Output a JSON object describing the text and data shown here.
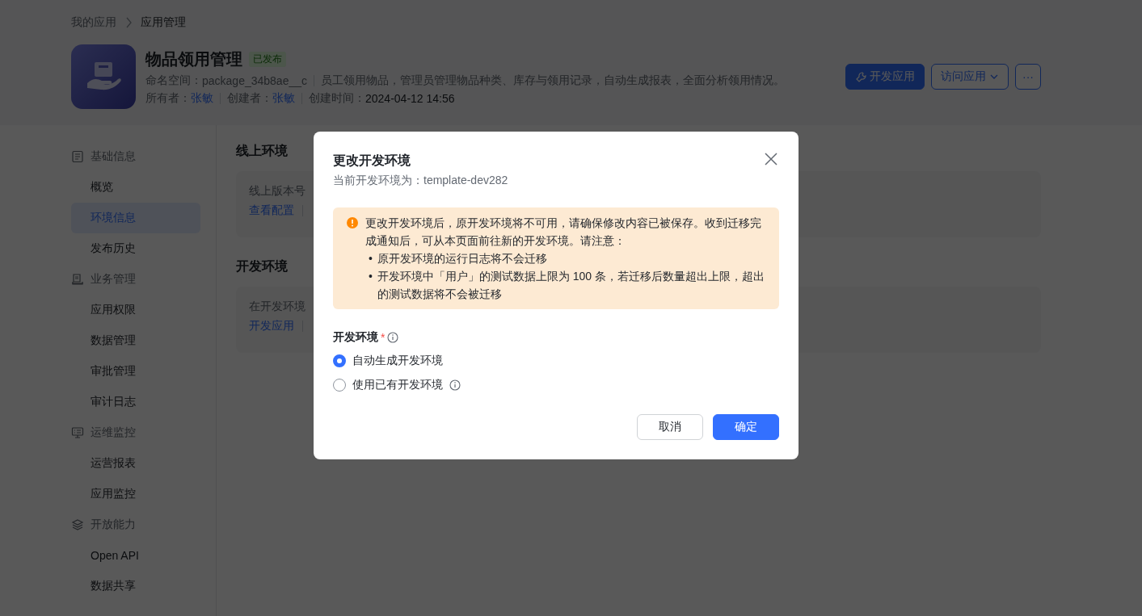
{
  "breadcrumb": [
    "我的应用",
    "应用管理"
  ],
  "app": {
    "name": "物品领用管理",
    "status": "已发布",
    "namespace_label": "命名空间：",
    "namespace": "package_34b8ae__c",
    "description": "员工领用物品，管理员管理物品种类、库存与领用记录，自动生成报表，全面分析领用情况。",
    "owner_label": "所有者：",
    "owner": "张敏",
    "creator_label": "创建者：",
    "creator": "张敏",
    "created_label": "创建时间：",
    "created": "2024-04-12 14:56"
  },
  "header_buttons": [
    {
      "kind": "primary",
      "label": "开发应用"
    },
    {
      "kind": "dropdown",
      "label": "访问应用"
    },
    {
      "kind": "more",
      "label": "···"
    }
  ],
  "sidebar": {
    "groups": [
      {
        "label": "基础信息",
        "items": [
          {
            "label": "概览",
            "selected": false
          },
          {
            "label": "环境信息",
            "selected": true
          },
          {
            "label": "发布历史",
            "selected": false
          }
        ]
      },
      {
        "label": "业务管理",
        "items": [
          {
            "label": "应用权限",
            "selected": false
          },
          {
            "label": "数据管理",
            "selected": false
          },
          {
            "label": "审批管理",
            "selected": false
          },
          {
            "label": "审计日志",
            "selected": false
          }
        ]
      },
      {
        "label": "运维监控",
        "items": [
          {
            "label": "运营报表",
            "selected": false
          },
          {
            "label": "应用监控",
            "selected": false
          }
        ]
      },
      {
        "label": "开放能力",
        "items": [
          {
            "label": "Open API",
            "selected": false
          },
          {
            "label": "数据共享",
            "selected": false
          }
        ]
      }
    ]
  },
  "sections": [
    {
      "title": "线上环境",
      "text": "线上版本号",
      "links": [
        "查看配置"
      ]
    },
    {
      "title": "开发环境",
      "text": "在开发环境",
      "links": [
        "开发应用"
      ]
    }
  ],
  "modal": {
    "title": "更改开发环境",
    "subtitle": "当前开发环境为：template-dev282",
    "alert": {
      "marker": "•",
      "text": "更改开发环境后，原开发环境将不可用，请确保修改内容已被保存。收到迁移完成通知后，可从本页面前往新的开发环境。请注意：",
      "bullets": [
        "原开发环境的运行日志将不会迁移",
        "开发环境中「用户」的测试数据上限为 100 条，若迁移后数量超出上限，超出的测试数据将不会被迁移"
      ]
    },
    "field": {
      "label": "开发环境",
      "required_mark": "*"
    },
    "options": [
      {
        "label": "自动生成开发环境",
        "selected": true,
        "info": false
      },
      {
        "label": "使用已有开发环境",
        "selected": false,
        "info": true
      }
    ],
    "buttons": [
      {
        "kind": "default",
        "label": "取消"
      },
      {
        "kind": "primary",
        "label": "确定"
      }
    ]
  }
}
